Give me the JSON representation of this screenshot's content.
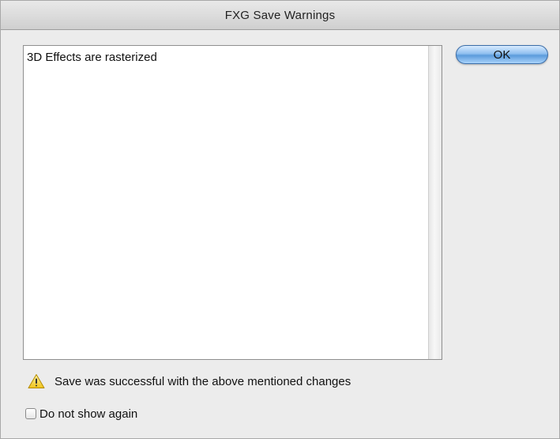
{
  "window": {
    "title": "FXG Save Warnings"
  },
  "warnings_list": {
    "items": [
      {
        "text": "3D Effects are rasterized"
      }
    ]
  },
  "buttons": {
    "ok_label": "OK"
  },
  "status": {
    "icon": "warning-triangle-icon",
    "message": "Save was successful with the above mentioned changes"
  },
  "options": {
    "do_not_show_again": {
      "label": "Do not show again",
      "checked": false
    }
  },
  "colors": {
    "window_background": "#ececec",
    "button_accent": "#5b9bdc",
    "warning_yellow": "#f5d94e"
  }
}
